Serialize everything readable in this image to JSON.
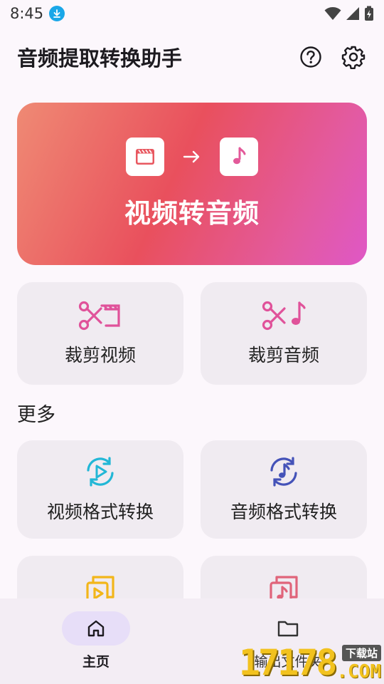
{
  "status_bar": {
    "time": "8:45",
    "download_icon": "download-arrow-icon",
    "wifi_icon": "wifi-icon",
    "signal_icon": "cell-signal-icon",
    "battery_icon": "battery-charging-icon"
  },
  "app_bar": {
    "title": "音频提取转换助手",
    "help_icon": "help-circle-icon",
    "settings_icon": "gear-icon"
  },
  "hero": {
    "title": "视频转音频",
    "from_icon": "video-clapper-icon",
    "arrow_icon": "arrow-right-icon",
    "to_icon": "music-note-icon",
    "gradient": [
      "#ef8a74",
      "#e9505d",
      "#df58c6"
    ]
  },
  "primary_actions": [
    {
      "label": "裁剪视频",
      "icon": "cut-video-icon"
    },
    {
      "label": "裁剪音频",
      "icon": "cut-audio-icon"
    }
  ],
  "more": {
    "title": "更多",
    "items": [
      {
        "label": "视频格式转换",
        "icon": "video-convert-icon"
      },
      {
        "label": "音频格式转换",
        "icon": "audio-convert-icon"
      },
      {
        "label": "",
        "icon": "video-merge-icon"
      },
      {
        "label": "",
        "icon": "audio-merge-icon"
      }
    ]
  },
  "bottom_nav": {
    "items": [
      {
        "label": "主页",
        "icon": "home-icon",
        "active": true
      },
      {
        "label": "输出文件夹",
        "icon": "folder-icon",
        "active": false
      }
    ]
  },
  "watermark": {
    "number": "17178",
    "tag": "下载站",
    "suffix": ".COM"
  },
  "colors": {
    "background": "#fcf7fc",
    "card": "#f0ebf1",
    "nav_bar": "#f3edf4",
    "nav_active_pill": "#e7def8",
    "accent_pink": "#e0529a",
    "accent_cyan": "#22b7d6",
    "accent_indigo": "#4452b8",
    "accent_yellow": "#f2b61a",
    "accent_red": "#e0647a"
  }
}
